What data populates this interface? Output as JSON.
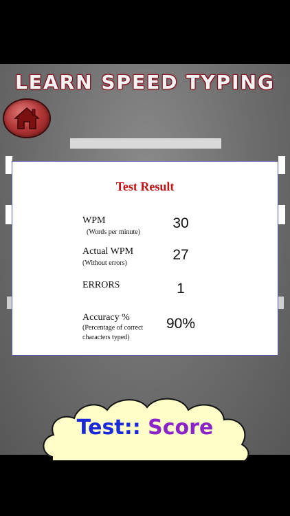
{
  "app": {
    "title": "LEARN SPEED TYPING"
  },
  "result": {
    "title": "Test Result",
    "rows": [
      {
        "label": "WPM",
        "sub": "(Words per minute)",
        "value": "30"
      },
      {
        "label": "Actual WPM",
        "sub": "(Without errors)",
        "value": "27"
      },
      {
        "label": "ERRORS",
        "sub": "",
        "value": "1"
      },
      {
        "label": "Accuracy %",
        "sub": "(Percentage of correct characters typed)",
        "value": "90%"
      }
    ]
  },
  "banner": {
    "part1": "Test::",
    "part2": "Score"
  },
  "icons": {
    "home": "home-icon"
  },
  "colors": {
    "title_outline": "#8a1020",
    "result_title": "#c01414",
    "banner_blue": "#1a2ad8",
    "banner_purple": "#8a24c8",
    "cloud_fill": "#fffdc8"
  }
}
